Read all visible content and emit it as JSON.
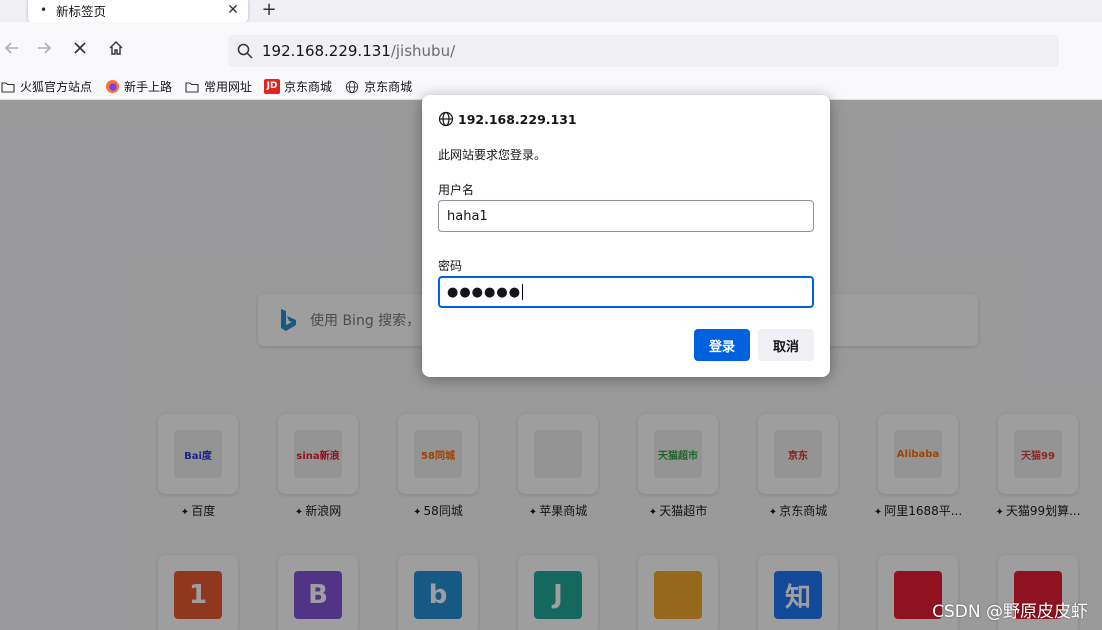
{
  "tab": {
    "title": "新标签页"
  },
  "navbar": {
    "url_host": "192.168.229.131",
    "url_path": "/jishubu/"
  },
  "bookmarks": [
    {
      "label": "火狐官方站点",
      "icon": "folder-icon"
    },
    {
      "label": "新手上路",
      "icon": "firefox-icon"
    },
    {
      "label": "常用网址",
      "icon": "folder-icon"
    },
    {
      "label": "京东商城",
      "icon": "jd-icon"
    },
    {
      "label": "京东商城",
      "icon": "globe-icon"
    }
  ],
  "search": {
    "placeholder": "使用 Bing 搜索，"
  },
  "tiles": [
    {
      "label": "百度",
      "logo": "Bai度",
      "color": "#2932e1"
    },
    {
      "label": "新浪网",
      "logo": "sina新浪",
      "color": "#e6162d"
    },
    {
      "label": "58同城",
      "logo": "58同城",
      "color": "#f60"
    },
    {
      "label": "苹果商城",
      "logo": "",
      "color": "#333"
    },
    {
      "label": "天猫超市",
      "logo": "天猫超市",
      "color": "#2b9f3f"
    },
    {
      "label": "京东商城",
      "logo": "京东",
      "color": "#e1251b"
    },
    {
      "label": "阿里1688平...",
      "logo": "Alibaba",
      "color": "#ff6a00"
    },
    {
      "label": "天猫99划算...",
      "logo": "天猫99",
      "color": "#e4393c"
    }
  ],
  "tiles_row2": [
    {
      "logo": "1",
      "color": "#e8562a"
    },
    {
      "logo": "B",
      "color": "#7d4fd9"
    },
    {
      "logo": "b",
      "color": "#1d8cd6"
    },
    {
      "logo": "J",
      "color": "#1aa693"
    },
    {
      "logo": "",
      "color": "#f5a623"
    },
    {
      "logo": "知",
      "color": "#1772f6"
    },
    {
      "logo": "",
      "color": "#e6162d"
    },
    {
      "logo": "",
      "color": "#e6162d"
    }
  ],
  "dialog": {
    "host": "192.168.229.131",
    "message": "此网站要求您登录。",
    "username_label": "用户名",
    "username_value": "haha1",
    "password_label": "密码",
    "password_value": "●●●●●●",
    "login_button": "登录",
    "cancel_button": "取消"
  },
  "watermark": "CSDN @野原皮皮虾"
}
